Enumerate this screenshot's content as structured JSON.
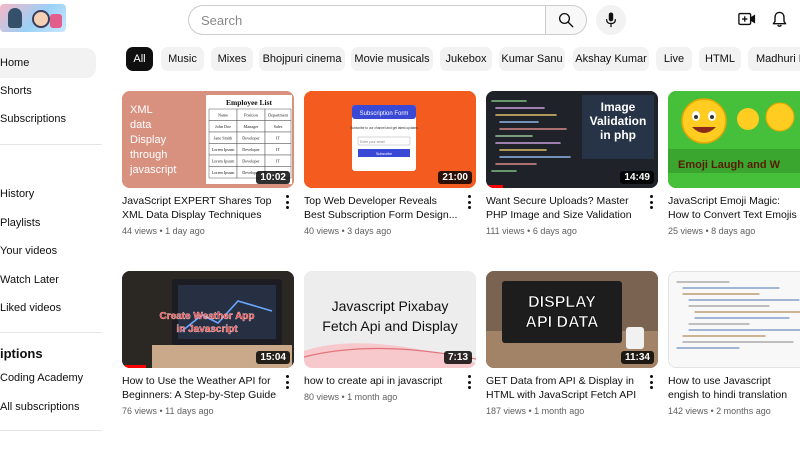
{
  "header": {
    "search_placeholder": "Search",
    "icons": [
      "search-icon",
      "mic-icon",
      "create-icon",
      "bell-icon"
    ]
  },
  "sidebar": {
    "primary": [
      {
        "label": "Home",
        "active": true
      },
      {
        "label": "Shorts"
      },
      {
        "label": "Subscriptions"
      }
    ],
    "you": [
      {
        "label": "History"
      },
      {
        "label": "Playlists"
      },
      {
        "label": "Your videos"
      },
      {
        "label": "Watch Later"
      },
      {
        "label": "Liked videos"
      }
    ],
    "subs_heading": "iptions",
    "subs": [
      {
        "label": "Coding Academy"
      },
      {
        "label": "All subscriptions"
      }
    ]
  },
  "chips": [
    "All",
    "Music",
    "Mixes",
    "Bhojpuri cinema",
    "Movie musicals",
    "Jukebox",
    "Kumar Sanu",
    "Akshay Kumar",
    "Live",
    "HTML",
    "Madhuri D"
  ],
  "colors": {
    "accent": "#ff0000",
    "chip_active_bg": "#0f0f0f",
    "chip_bg": "#f2f2f2",
    "meta_text": "#606060"
  },
  "videos": [
    {
      "title": "JavaScript EXPERT Shares Top XML Data Display Techniques",
      "meta": "44 views • 1 day ago",
      "duration": "10:02",
      "progress": 0.0,
      "thumb_text": [
        "XML",
        "data",
        "Display",
        "through",
        "javascript"
      ],
      "thumb_table_title": "Employee List",
      "thumb_table_headers": [
        "Name",
        "Position",
        "Department"
      ],
      "thumb_table_rows": [
        [
          "John Doe",
          "Manager",
          "Sales"
        ],
        [
          "Jane Smith",
          "Developer",
          "IT"
        ],
        [
          "Lorem Ipsum",
          "Developer",
          "IT"
        ],
        [
          "Lorem Ipsum",
          "Developer",
          "IT"
        ],
        [
          "Lorem Ipsum",
          "Developer",
          "IT"
        ]
      ]
    },
    {
      "title": "Top Web Developer Reveals Best Subscription Form Design...",
      "meta": "40 views • 3 days ago",
      "duration": "21:00",
      "progress": 0.0,
      "thumb_form_title": "Subscription Form",
      "thumb_form_sub": "Subscribe to our channel and get latest updates",
      "thumb_form_placeholder": "Enter your email",
      "thumb_form_button": "Subscribe"
    },
    {
      "title": "Want Secure Uploads? Master PHP Image and Size Validation Now",
      "meta": "111 views • 6 days ago",
      "duration": "14:49",
      "progress": 0.1,
      "thumb_text": "Image Validation in php"
    },
    {
      "title": "JavaScript Emoji Magic: How to Convert Text Emojis to Text! 🎉 🖥️ ✨",
      "meta": "25 views • 8 days ago",
      "duration": "",
      "progress": 0.0,
      "thumb_text": "Emoji Laugh and W"
    },
    {
      "title": "How to Use the Weather API for Beginners: A Step-by-Step Guide t...",
      "meta": "76 views • 11 days ago",
      "duration": "15:04",
      "progress": 0.14,
      "thumb_text": [
        "Create Weather App",
        "in Javascript"
      ]
    },
    {
      "title": "how to create api in javascript",
      "meta": "80 views • 1 month ago",
      "duration": "7:13",
      "progress": 0.0,
      "thumb_text": [
        "Javascript Pixabay",
        "Fetch Api and Display"
      ]
    },
    {
      "title": "GET Data from API & Display in HTML with JavaScript Fetch API",
      "meta": "187 views • 1 month ago",
      "duration": "11:34",
      "progress": 0.0,
      "thumb_text": [
        "DISPLAY",
        "API DATA"
      ]
    },
    {
      "title": "How to use Javascript engish to hindi translation with voice?",
      "meta": "142 views • 2 months ago",
      "duration": "",
      "progress": 0.0
    }
  ]
}
